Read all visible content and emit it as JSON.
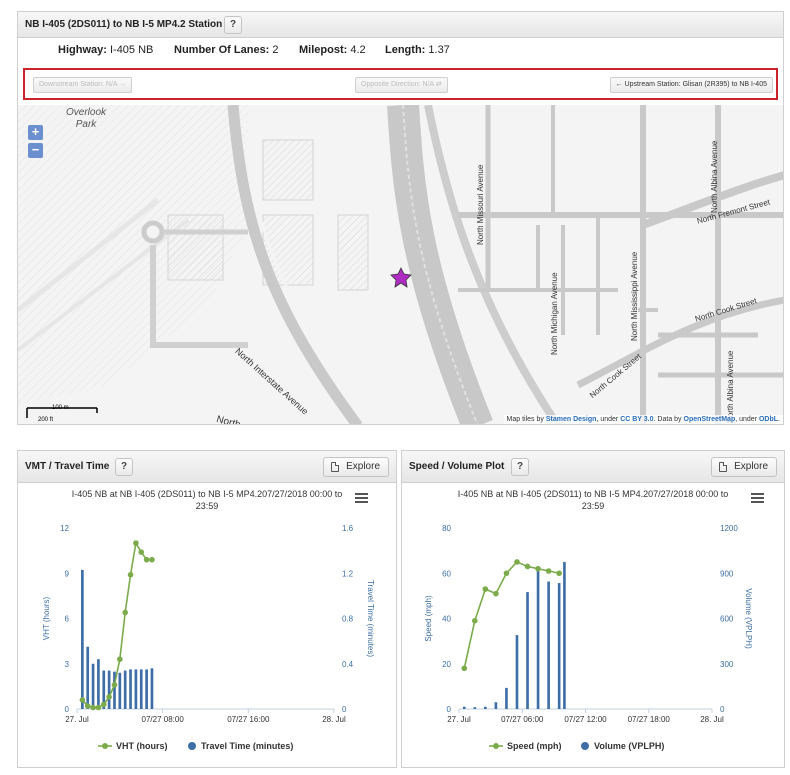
{
  "station": {
    "title": "NB I-405 (2DS011) to NB I-5 MP4.2 Station",
    "help_label": "?",
    "highway_label": "Highway:",
    "highway_value": "I-405 NB",
    "lanes_label": "Number Of Lanes:",
    "lanes_value": "2",
    "milepost_label": "Milepost:",
    "milepost_value": "4.2",
    "length_label": "Length:",
    "length_value": "1.37",
    "downstream_label": "Downstream Station: N/A",
    "opposite_label": "Opposite Direction: N/A",
    "upstream_label": "Upstream Station: Glisan (2R395) to NB I-405"
  },
  "map": {
    "zoom_in": "+",
    "zoom_out": "−",
    "scale_m": "100 m",
    "scale_ft": "200 ft",
    "labels": {
      "park": "Overlook Park",
      "park_line1": "Overlook",
      "park_line2": "Park",
      "interstate1": "North Interstate Avenue",
      "interstate2": "North",
      "missouri": "North Missouri Avenue",
      "michigan": "North Michigan Avenue",
      "mississippi": "North Mississippi Avenue",
      "albina1": "North Albina Avenue",
      "albina2": "North Albina Avenue",
      "fremont": "North Fremont Street",
      "cook1": "North Cook Street",
      "cook2": "North Cook Street"
    },
    "attribution": {
      "prefix": "Map tiles by",
      "stamen": "Stamen Design",
      "under1": ", under",
      "ccby": "CC BY 3.0",
      "data_by": ". Data by",
      "osm": "OpenStreetMap",
      "under2": ", under",
      "odbl": "ODbL",
      "end": "."
    },
    "colors": {
      "marker": "#b02bc2"
    }
  },
  "vmt_panel": {
    "title": "VMT / Travel Time",
    "help_label": "?",
    "explore_label": "Explore"
  },
  "speed_panel": {
    "title": "Speed / Volume Plot",
    "help_label": "?",
    "explore_label": "Explore"
  },
  "chart_data": [
    {
      "type": "bar",
      "title_line1": "I-405 NB at NB I-405 (2DS011) to NB I-5 MP4.207/27/2018 00:00 to",
      "title_line2": "23:59",
      "ylabel": "VHT (hours)",
      "y2label": "Travel Time (minutes)",
      "ylim": [
        0,
        12
      ],
      "y2lim": [
        0,
        1.6
      ],
      "yticks": [
        "0",
        "3",
        "6",
        "9",
        "12"
      ],
      "y2ticks": [
        "0",
        "0.4",
        "0.8",
        "1.2",
        "1.6"
      ],
      "xticks": [
        "27. Jul",
        "07/27 08:00",
        "07/27 16:00",
        "28. Jul"
      ],
      "xrange_hours": [
        0,
        24
      ],
      "series": [
        {
          "name": "VHT (hours)",
          "type": "line",
          "axis": "left",
          "color": "#7cab4b",
          "x_hours": [
            0.5,
            1,
            1.5,
            2,
            2.5,
            3,
            3.5,
            4,
            4.5,
            5,
            5.5,
            6,
            6.5,
            7
          ],
          "values": [
            0.6,
            0.2,
            0.1,
            0.1,
            0.3,
            0.8,
            1.6,
            3.3,
            6.4,
            8.9,
            11.0,
            10.4,
            9.9,
            9.9
          ]
        },
        {
          "name": "Travel Time (minutes)",
          "type": "bar",
          "axis": "right",
          "color": "#3d6ea5",
          "x_hours": [
            0.5,
            1,
            1.5,
            2,
            2.5,
            3,
            3.5,
            4,
            4.5,
            5,
            5.5,
            6,
            6.5,
            7
          ],
          "values": [
            1.23,
            0.55,
            0.4,
            0.44,
            0.34,
            0.34,
            0.33,
            0.32,
            0.34,
            0.35,
            0.35,
            0.35,
            0.35,
            0.36
          ]
        }
      ]
    },
    {
      "type": "bar",
      "title_line1": "I-405 NB at NB I-405 (2DS011) to NB I-5 MP4.207/27/2018 00:00 to",
      "title_line2": "23:59",
      "ylabel": "Speed (mph)",
      "y2label": "Volume (VPLPH)",
      "ylim": [
        0,
        80
      ],
      "y2lim": [
        0,
        1200
      ],
      "yticks": [
        "0",
        "20",
        "40",
        "60",
        "80"
      ],
      "y2ticks": [
        "0",
        "300",
        "600",
        "900",
        "1200"
      ],
      "xticks": [
        "27. Jul",
        "07/27 06:00",
        "07/27 12:00",
        "07/27 18:00",
        "28. Jul"
      ],
      "xrange_hours": [
        0,
        24
      ],
      "series": [
        {
          "name": "Speed (mph)",
          "type": "line",
          "axis": "left",
          "color": "#7cab4b",
          "x_hours": [
            0.5,
            1.5,
            2.5,
            3.5,
            4.5,
            5.5,
            6.5,
            7.5,
            8.5,
            9.5
          ],
          "values": [
            18,
            39,
            53,
            51,
            60,
            65,
            63,
            62,
            61,
            60
          ]
        },
        {
          "name": "Volume (VPLPH)",
          "type": "bar",
          "axis": "right",
          "color": "#3d6ea5",
          "x_hours": [
            0.5,
            1.5,
            2.5,
            3.5,
            4.5,
            5.5,
            6.5,
            7.5,
            8.5,
            9.5
          ],
          "values": [
            15,
            12,
            15,
            45,
            140,
            490,
            775,
            930,
            845,
            835,
            975
          ]
        }
      ]
    }
  ]
}
